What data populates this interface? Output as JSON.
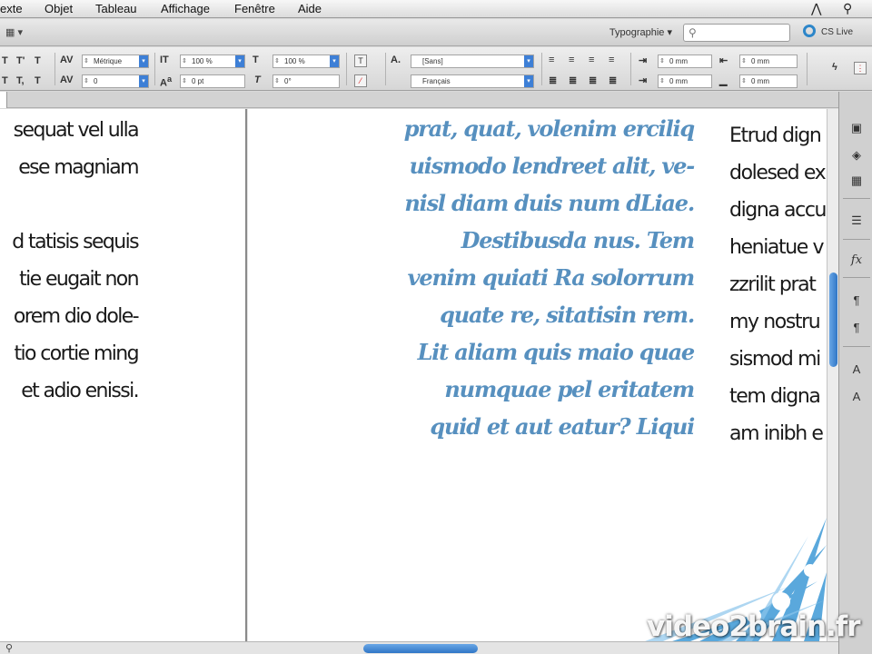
{
  "menubar": {
    "items": [
      "exte",
      "Objet",
      "Tableau",
      "Affichage",
      "Fenêtre",
      "Aide"
    ]
  },
  "appbar": {
    "workspace": "Typographie ▾",
    "search_placeholder": "",
    "cslive": "CS Live"
  },
  "control": {
    "tracking_kerning": "Métrique",
    "tracking_value": "0",
    "vscale": "100 %",
    "hscale": "100 %",
    "baseline": "0 pt",
    "skew": "0°",
    "font_family": "[Sans]",
    "language": "Français",
    "indent_left": "0 mm",
    "indent_right": "0 mm",
    "indent_first": "0 mm",
    "indent_last": "0 mm",
    "space_before": "0 mm",
    "space_after": "0 mm"
  },
  "document": {
    "left_column": [
      "sequat vel ulla",
      "ese magniam",
      "",
      "d tatisis sequis",
      "tie eugait non",
      "orem dio dole-",
      "tio cortie ming",
      "et adio enissi."
    ],
    "quote_column": [
      "prat, quat, volenim erciliq",
      "uismodo lendreet alit, ve-",
      "nisl diam duis num dLiae.",
      "Destibusda nus. Tem",
      "venim quiati Ra solorrum",
      "quate re, sitatisin rem.",
      "Lit aliam quis maio quae",
      "numquae pel eritatem",
      "quid et aut eatur? Liqui"
    ],
    "right_column": [
      "Etrud dign",
      "dolesed ex",
      "digna accu",
      "heniatue v",
      "zzrilit prat",
      "my nostru",
      "sismod mi",
      "tem digna",
      "am inibh e"
    ]
  },
  "watermark": "video2brain.fr",
  "colors": {
    "quote_text": "#5790bf",
    "accent_blue": "#2f76c6"
  }
}
